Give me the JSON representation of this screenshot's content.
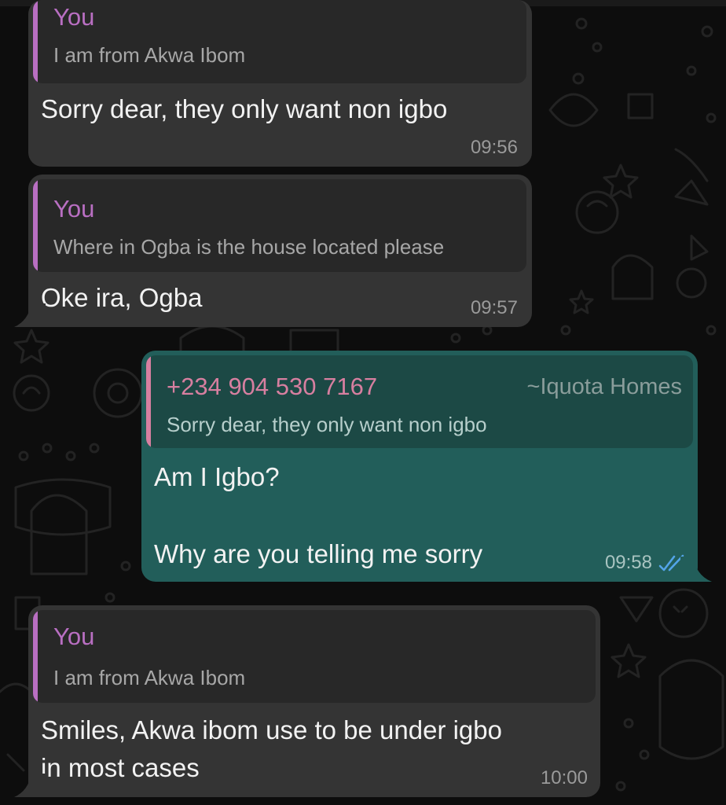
{
  "colors": {
    "background": "#0d0d0d",
    "incoming_bubble": "#343434",
    "outgoing_bubble": "#225e5a",
    "quote_author_you": "#b96fc2",
    "quote_author_number": "#d77fa0",
    "read_receipt": "#53a4e8"
  },
  "messages": [
    {
      "direction": "incoming",
      "quote": {
        "author": "You",
        "text": "I am from Akwa Ibom"
      },
      "text_lines": [
        "Sorry dear, they only want non igbo"
      ],
      "time": "09:56"
    },
    {
      "direction": "incoming",
      "quote": {
        "author": "You",
        "text": "Where in Ogba is the house located please"
      },
      "text_lines": [
        "Oke ira, Ogba"
      ],
      "time": "09:57"
    },
    {
      "direction": "outgoing",
      "quote": {
        "author": "+234 904 530 7167",
        "tag": "~Iquota Homes",
        "text": "Sorry dear, they only want non igbo"
      },
      "text_lines": [
        "Am I Igbo?",
        "",
        "Why are you telling me sorry"
      ],
      "time": "09:58",
      "status_icon": "double-check-read-icon"
    },
    {
      "direction": "incoming",
      "quote": {
        "author": "You",
        "text": "I am from Akwa Ibom"
      },
      "text_lines": [
        "Smiles, Akwa ibom use to be under igbo",
        "in most cases"
      ],
      "time": "10:00"
    }
  ]
}
